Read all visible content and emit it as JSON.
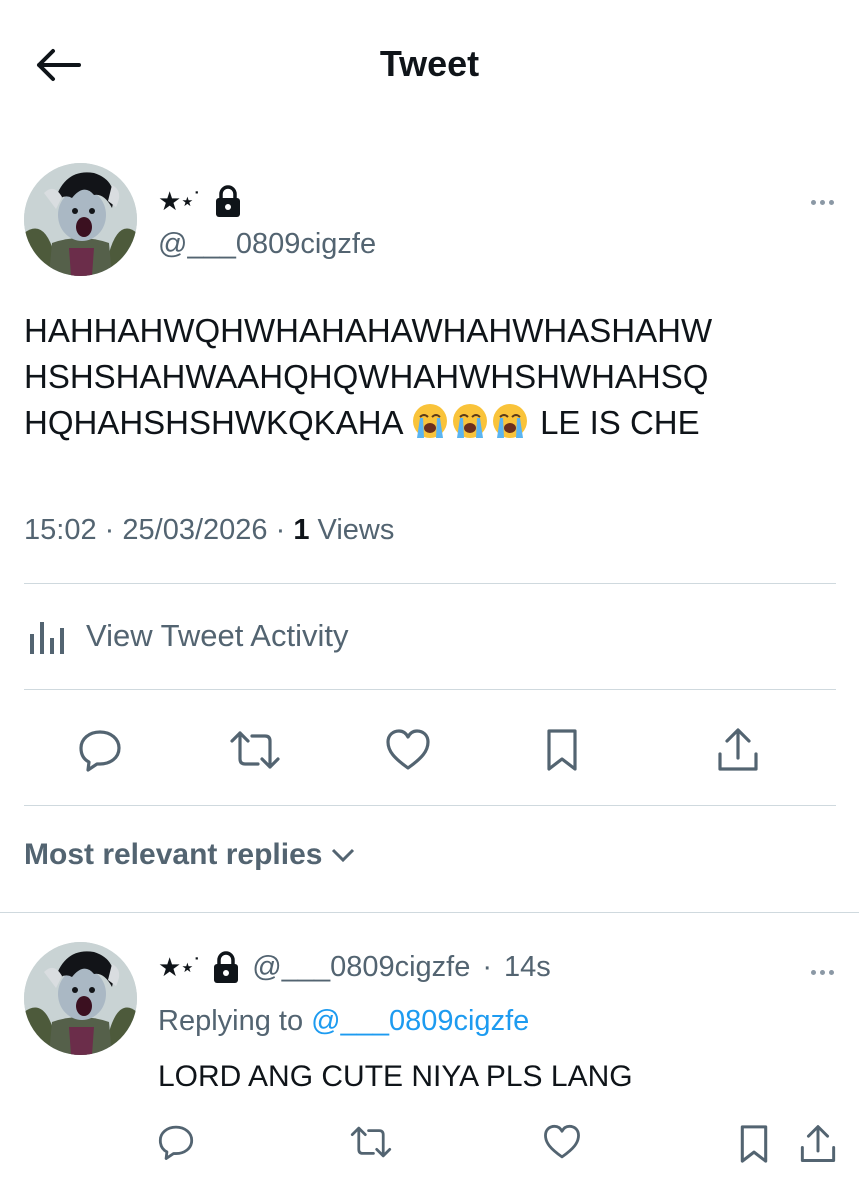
{
  "header": {
    "title": "Tweet",
    "back_icon": "arrow-left-icon"
  },
  "tweet": {
    "display_name_stars": "★⋆˙",
    "lock_icon": "lock-icon",
    "handle": "@___0809cigzfe",
    "text_line1": "HAHHAHWQHWHAHAHAWHAHWHASHAHW",
    "text_line2": "HSHSHAHWAAHQHQWHAHWHSHWHAHSQ",
    "text_line3": "HQHAHSHSHWKQKAHA",
    "emojis": [
      "loudly-crying-face-icon",
      "loudly-crying-face-icon",
      "loudly-crying-face-icon"
    ],
    "text_suffix": " LE IS CHE",
    "time": "15:02",
    "date": "25/03/2026",
    "views_count": "1",
    "views_label": "Views",
    "separator": "·"
  },
  "activity": {
    "label": "View Tweet Activity",
    "icon": "analytics-icon"
  },
  "actions": [
    "reply-icon",
    "retweet-icon",
    "like-icon",
    "bookmark-icon",
    "share-icon"
  ],
  "replies_sort": {
    "label": "Most relevant replies"
  },
  "reply": {
    "handle": "@___0809cigzfe",
    "separator": "·",
    "time": "14s",
    "replying_prefix": "Replying to",
    "replying_to": "@___0809cigzfe",
    "text": "LORD ANG CUTE NIYA PLS LANG"
  }
}
